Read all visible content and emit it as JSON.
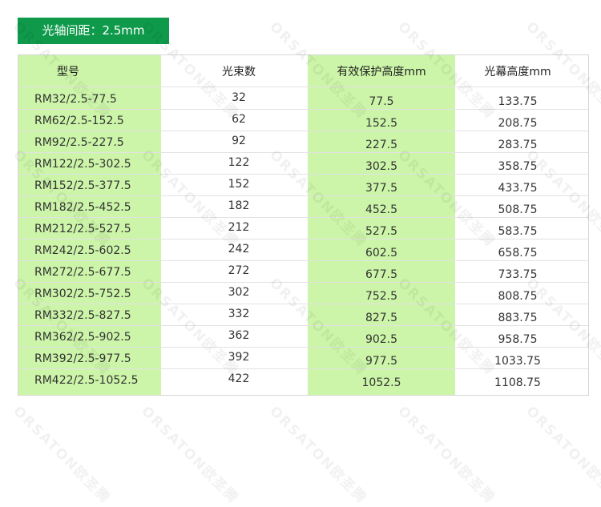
{
  "title": "光轴间距：2.5mm",
  "watermark": "ORSATON欧圣腾",
  "colors": {
    "badge": "#0f9a4b",
    "highlight": "#ccf5a9",
    "border": "#d6d6d6"
  },
  "table": {
    "headers": [
      "型号",
      "光束数",
      "有效保护高度mm",
      "光幕高度mm"
    ],
    "rows": [
      [
        "RM32/2.5-77.5",
        "32",
        "77.5",
        "133.75"
      ],
      [
        "RM62/2.5-152.5",
        "62",
        "152.5",
        "208.75"
      ],
      [
        "RM92/2.5-227.5",
        "92",
        "227.5",
        "283.75"
      ],
      [
        "RM122/2.5-302.5",
        "122",
        "302.5",
        "358.75"
      ],
      [
        "RM152/2.5-377.5",
        "152",
        "377.5",
        "433.75"
      ],
      [
        "RM182/2.5-452.5",
        "182",
        "452.5",
        "508.75"
      ],
      [
        "RM212/2.5-527.5",
        "212",
        "527.5",
        "583.75"
      ],
      [
        "RM242/2.5-602.5",
        "242",
        "602.5",
        "658.75"
      ],
      [
        "RM272/2.5-677.5",
        "272",
        "677.5",
        "733.75"
      ],
      [
        "RM302/2.5-752.5",
        "302",
        "752.5",
        "808.75"
      ],
      [
        "RM332/2.5-827.5",
        "332",
        "827.5",
        "883.75"
      ],
      [
        "RM362/2.5-902.5",
        "362",
        "902.5",
        "958.75"
      ],
      [
        "RM392/2.5-977.5",
        "392",
        "977.5",
        "1033.75"
      ],
      [
        "RM422/2.5-1052.5",
        "422",
        "1052.5",
        "1108.75"
      ]
    ]
  }
}
